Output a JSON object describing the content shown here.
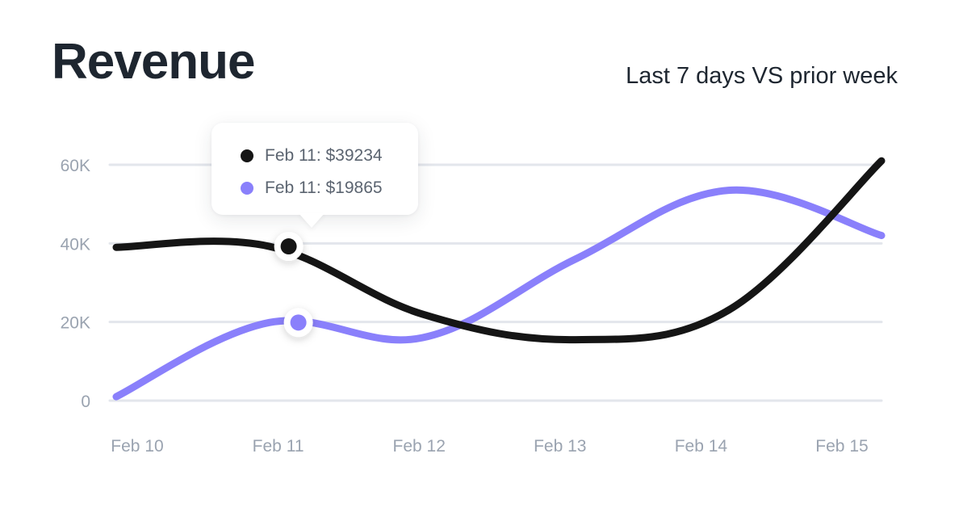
{
  "header": {
    "title": "Revenue",
    "subtitle": "Last 7 days VS prior week"
  },
  "tooltip": {
    "rows": [
      {
        "label": "Feb 11: $39234",
        "color": "#151515"
      },
      {
        "label": "Feb 11: $19865",
        "color": "#8a80fb"
      }
    ]
  },
  "chart_data": {
    "type": "line",
    "title": "Revenue",
    "subtitle": "Last 7 days VS prior week",
    "xlabel": "",
    "ylabel": "",
    "categories": [
      "Feb 10",
      "Feb 11",
      "Feb 12",
      "Feb 13",
      "Feb 14",
      "Feb 15"
    ],
    "ytick_labels": [
      "0",
      "20K",
      "40K",
      "60K"
    ],
    "ylim": [
      0,
      60000
    ],
    "grid": true,
    "legend": "none",
    "series": [
      {
        "color": "#151515",
        "values": [
          39000,
          39234,
          22000,
          15500,
          23000,
          61000
        ]
      },
      {
        "color": "#8a80fb",
        "values": [
          1000,
          19865,
          16000,
          36000,
          53500,
          42000
        ]
      }
    ],
    "highlight": {
      "category": "Feb 11",
      "values": [
        39234,
        19865
      ]
    }
  }
}
